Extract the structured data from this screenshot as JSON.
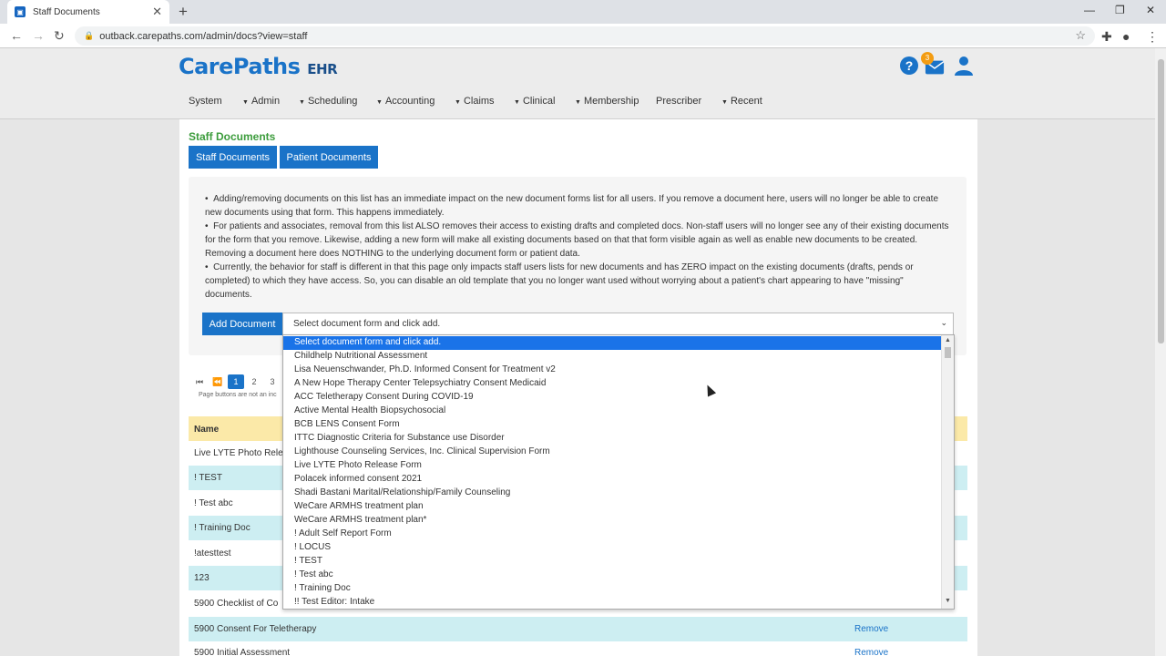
{
  "browser": {
    "tab_title": "Staff Documents",
    "url": "outback.carepaths.com/admin/docs?view=staff"
  },
  "app": {
    "logo": "CarePaths",
    "logo_sub": "EHR",
    "badge_count": "3"
  },
  "menu": [
    "System",
    "Admin",
    "Scheduling",
    "Accounting",
    "Claims",
    "Clinical",
    "Membership",
    "Prescriber",
    "Recent"
  ],
  "page": {
    "title": "Staff Documents",
    "tab_staff": "Staff Documents",
    "tab_patient": "Patient Documents",
    "bullets": [
      "Adding/removing documents on this list has an immediate impact on the new document forms list for all users. If you remove a document here, users will no longer be able to create new documents using that form. This happens immediately.",
      "For patients and associates, removal from this list ALSO removes their access to existing drafts and completed docs. Non-staff users will no longer see any of their existing documents for the form that you remove. Likewise, adding a new form will make all existing documents based on that that form visible again as well as enable new documents to be created. Removing a document here does NOTHING to the underlying document form or patient data.",
      "Currently, the behavior for staff is different in that this page only impacts staff users lists for new documents and has ZERO impact on the existing documents (drafts, pends or completed) to which they have access. So, you can disable an old template that you no longer want used without worrying about a patient's chart appearing to have \"missing\" documents."
    ],
    "add_button": "Add Document",
    "select_placeholder": "Select document form and click add.",
    "pages": [
      "1",
      "2",
      "3"
    ],
    "pager_note": "Page buttons are not an inc",
    "table_header": "Name",
    "rows": [
      {
        "name": "Live LYTE Photo Rele",
        "remove": ""
      },
      {
        "name": "! TEST",
        "remove": ""
      },
      {
        "name": "! Test abc",
        "remove": ""
      },
      {
        "name": "! Training Doc",
        "remove": ""
      },
      {
        "name": "!atesttest",
        "remove": ""
      },
      {
        "name": "123",
        "remove": ""
      },
      {
        "name": "5900 Checklist of Co",
        "remove": ""
      },
      {
        "name": "5900 Consent For Teletherapy",
        "remove": "Remove"
      },
      {
        "name": "5900 Initial Assessment",
        "remove": "Remove"
      }
    ]
  },
  "dropdown": {
    "options": [
      "Select document form and click add.",
      "Childhelp Nutritional Assessment",
      "Lisa Neuenschwander, Ph.D. Informed Consent for Treatment v2",
      "A New Hope Therapy Center Telepsychiatry Consent Medicaid",
      "ACC Teletherapy Consent During COVID-19",
      "Active Mental Health Biopsychosocial",
      "BCB LENS Consent Form",
      "ITTC Diagnostic Criteria for Substance use Disorder",
      "Lighthouse Counseling Services, Inc. Clinical Supervision Form",
      "Live LYTE Photo Release Form",
      "Polacek informed consent 2021",
      "Shadi Bastani Marital/Relationship/Family Counseling",
      "WeCare ARMHS treatment plan",
      "WeCare ARMHS treatment plan*",
      "! Adult Self Report Form",
      "! LOCUS",
      "! TEST",
      "! Test abc",
      "! Training Doc",
      "!! Test Editor: Intake"
    ]
  },
  "colors": {
    "accent": "#1a73c8",
    "title_green": "#3c9c3c",
    "row_alt": "#cdeef2",
    "header_yellow": "#fbe9a8"
  }
}
